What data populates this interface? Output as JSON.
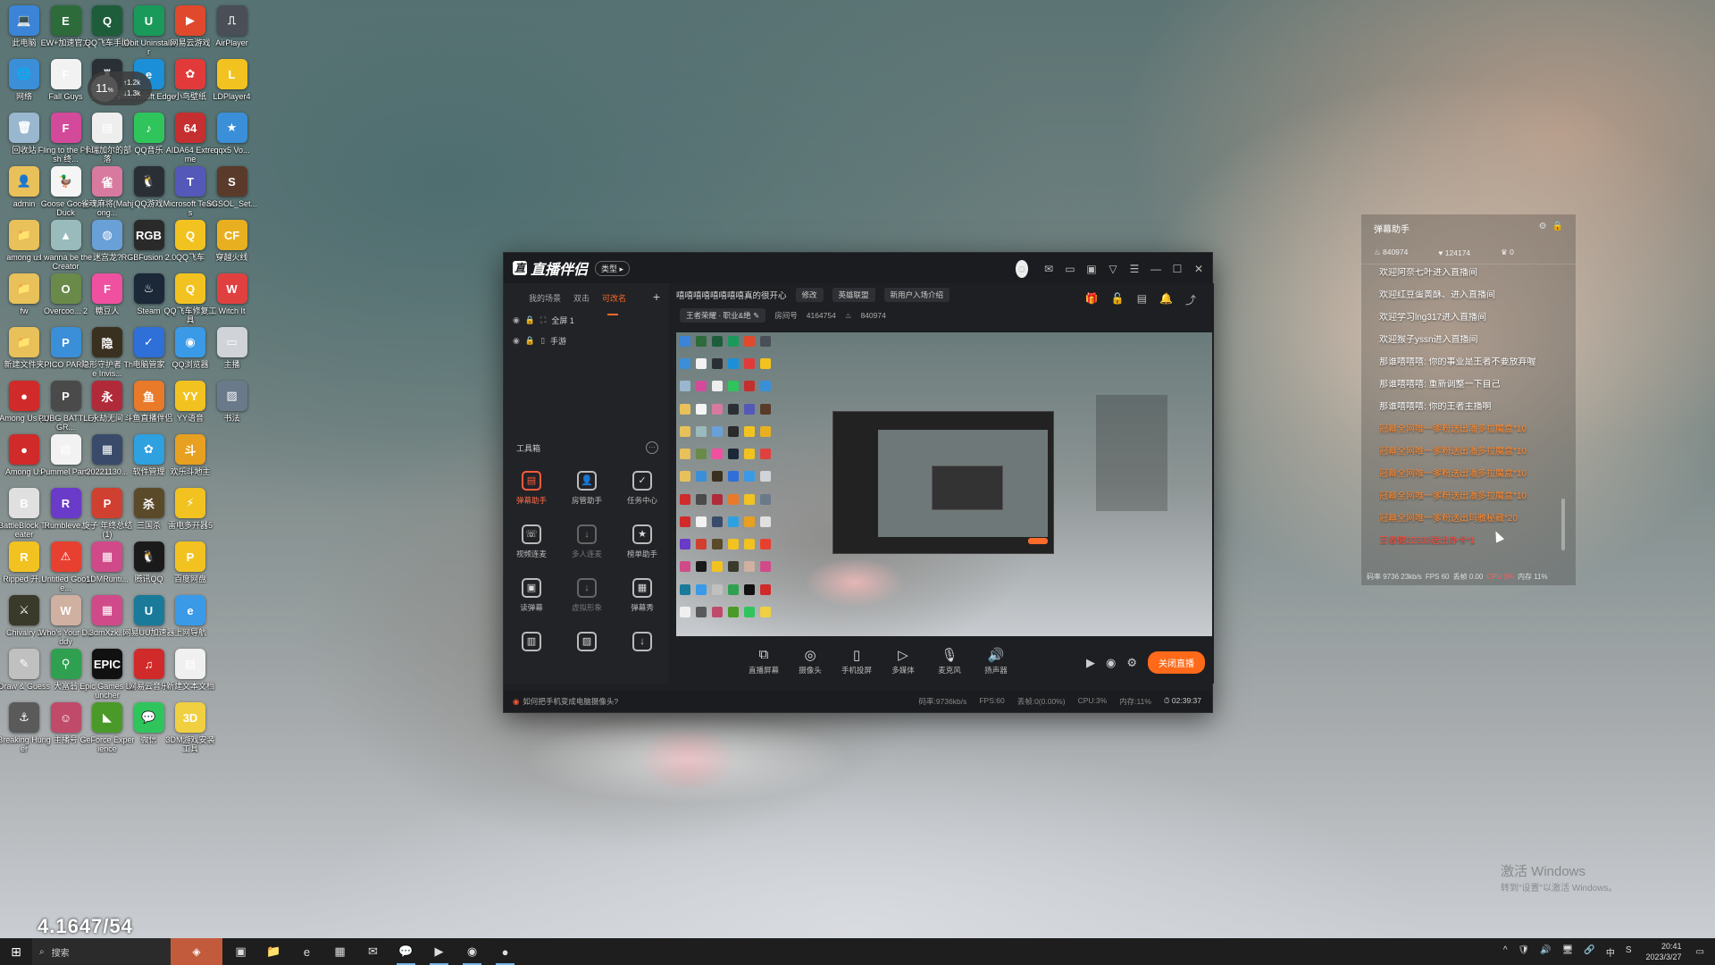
{
  "desktop": {
    "icons": [
      {
        "label": "此电脑",
        "color": "#3b84d8",
        "g": "💻",
        "col": 0,
        "row": 0
      },
      {
        "label": "EW+加速官方",
        "color": "#2d6b3a",
        "g": "E",
        "col": 1,
        "row": 0
      },
      {
        "label": "QQ飞车手游",
        "color": "#1d5d3a",
        "g": "Q",
        "col": 2,
        "row": 0
      },
      {
        "label": "IObit Uninstaller",
        "color": "#1a9a5a",
        "g": "U",
        "col": 3,
        "row": 0
      },
      {
        "label": "网易云游戏",
        "color": "#e0492c",
        "g": "▶",
        "col": 4,
        "row": 0
      },
      {
        "label": "AirPlayer",
        "color": "#4a4f57",
        "g": "⎍",
        "col": 5,
        "row": 0
      },
      {
        "label": "网络",
        "color": "#3a8fd8",
        "g": "🌐",
        "col": 0,
        "row": 1
      },
      {
        "label": "Fall Guys",
        "color": "#f2f2f2",
        "g": "F",
        "col": 1,
        "row": 1
      },
      {
        "label": "道具实录",
        "color": "#2a2f36",
        "g": "♜",
        "col": 2,
        "row": 1
      },
      {
        "label": "Microsoft Edge",
        "color": "#1b8fd8",
        "g": "e",
        "col": 3,
        "row": 1
      },
      {
        "label": "小鸟壁纸",
        "color": "#e23a3a",
        "g": "✿",
        "col": 4,
        "row": 1
      },
      {
        "label": "LDPlayer4",
        "color": "#f2c320",
        "g": "L",
        "col": 5,
        "row": 1
      },
      {
        "label": "回收站",
        "color": "#9ab7d0",
        "g": "🗑",
        "col": 0,
        "row": 2
      },
      {
        "label": "Fling to the Finish 终...",
        "color": "#d44a9a",
        "g": "F",
        "col": 1,
        "row": 2
      },
      {
        "label": "卡瑞加尔的部落",
        "color": "#eeeeee",
        "g": "▤",
        "col": 2,
        "row": 2
      },
      {
        "label": "QQ音乐",
        "color": "#2fc55c",
        "g": "♪",
        "col": 3,
        "row": 2
      },
      {
        "label": "AIDA64 Extreme",
        "color": "#c62f2f",
        "g": "64",
        "col": 4,
        "row": 2
      },
      {
        "label": "qqx5 Vo...",
        "color": "#3a8fd8",
        "g": "★",
        "col": 5,
        "row": 2
      },
      {
        "label": "admin",
        "color": "#e8c15a",
        "g": "👤",
        "col": 0,
        "row": 3
      },
      {
        "label": "Goose Goose Duck",
        "color": "#f5f5f5",
        "g": "🦆",
        "col": 1,
        "row": 3
      },
      {
        "label": "雀魂麻将(Mahjong...",
        "color": "#d87aa0",
        "g": "雀",
        "col": 2,
        "row": 3
      },
      {
        "label": "QQ游戏",
        "color": "#2a2f36",
        "g": "🐧",
        "col": 3,
        "row": 3
      },
      {
        "label": "Microsoft Teams",
        "color": "#5458b8",
        "g": "T",
        "col": 4,
        "row": 3
      },
      {
        "label": "SGSOL_Set...",
        "color": "#5a3a2a",
        "g": "S",
        "col": 5,
        "row": 3
      },
      {
        "label": "among us",
        "color": "#e8c15a",
        "g": "📁",
        "col": 0,
        "row": 4
      },
      {
        "label": "I wanna be the Creator",
        "color": "#9bb",
        "g": "▲",
        "col": 1,
        "row": 4
      },
      {
        "label": "迷宫龙?",
        "color": "#6aa0d8",
        "g": "◍",
        "col": 2,
        "row": 4
      },
      {
        "label": "RGBFusion 2.0",
        "color": "#2a2a2a",
        "g": "RGB",
        "col": 3,
        "row": 4
      },
      {
        "label": "QQ飞车",
        "color": "#f2c320",
        "g": "Q",
        "col": 4,
        "row": 4
      },
      {
        "label": "穿越火线",
        "color": "#e8b020",
        "g": "CF",
        "col": 5,
        "row": 4
      },
      {
        "label": "fw",
        "color": "#e8c15a",
        "g": "📁",
        "col": 0,
        "row": 5
      },
      {
        "label": "Overcoo... 2",
        "color": "#6a8a4a",
        "g": "O",
        "col": 1,
        "row": 5
      },
      {
        "label": "糖豆人",
        "color": "#f050a0",
        "g": "F",
        "col": 2,
        "row": 5
      },
      {
        "label": "Steam",
        "color": "#1b2838",
        "g": "♨",
        "col": 3,
        "row": 5
      },
      {
        "label": "QQ飞车修复工具",
        "color": "#f2c320",
        "g": "Q",
        "col": 4,
        "row": 5
      },
      {
        "label": "Witch It",
        "color": "#e04040",
        "g": "W",
        "col": 5,
        "row": 5
      },
      {
        "label": "新建文件夹",
        "color": "#e8c15a",
        "g": "📁",
        "col": 0,
        "row": 6
      },
      {
        "label": "PICO PARK",
        "color": "#3a8fd8",
        "g": "P",
        "col": 1,
        "row": 6
      },
      {
        "label": "隐形守护者 The Invis...",
        "color": "#3a3020",
        "g": "隐",
        "col": 2,
        "row": 6
      },
      {
        "label": "电脑管家",
        "color": "#2f6fd8",
        "g": "✓",
        "col": 3,
        "row": 6
      },
      {
        "label": "QQ浏览器",
        "color": "#3a9ae8",
        "g": "◉",
        "col": 4,
        "row": 6
      },
      {
        "label": "主播",
        "color": "#d0d4d8",
        "g": "▭",
        "col": 5,
        "row": 6
      },
      {
        "label": "Among Us (2)",
        "color": "#d02a2a",
        "g": "●",
        "col": 0,
        "row": 7
      },
      {
        "label": "PUBG BATTLEGR...",
        "color": "#4a4a4a",
        "g": "P",
        "col": 1,
        "row": 7
      },
      {
        "label": "永劫无间",
        "color": "#b02a3a",
        "g": "永",
        "col": 2,
        "row": 7
      },
      {
        "label": "斗鱼直播伴侣",
        "color": "#e87a2a",
        "g": "鱼",
        "col": 3,
        "row": 7
      },
      {
        "label": "YY语音",
        "color": "#f2c320",
        "g": "YY",
        "col": 4,
        "row": 7
      },
      {
        "label": "书法",
        "color": "#6a7a8a",
        "g": "▨",
        "col": 5,
        "row": 7
      },
      {
        "label": "Among Us",
        "color": "#d02a2a",
        "g": "●",
        "col": 0,
        "row": 8
      },
      {
        "label": "Pummel Party",
        "color": "#f2f2f2",
        "g": "▤",
        "col": 1,
        "row": 8
      },
      {
        "label": "20221130...",
        "color": "#3a4a6a",
        "g": "▦",
        "col": 2,
        "row": 8
      },
      {
        "label": "软件管理",
        "color": "#2fa0e0",
        "g": "✿",
        "col": 3,
        "row": 8
      },
      {
        "label": "欢乐斗地主",
        "color": "#e8a020",
        "g": "斗",
        "col": 4,
        "row": 8
      },
      {
        "label": "BattleBlock Theater",
        "color": "#e0e0e0",
        "g": "B",
        "col": 0,
        "row": 9
      },
      {
        "label": "Rumbleve...",
        "color": "#6a3ac8",
        "g": "R",
        "col": 1,
        "row": 9
      },
      {
        "label": "旋子 年终总结(1)",
        "color": "#d04030",
        "g": "P",
        "col": 2,
        "row": 9
      },
      {
        "label": "三国杀",
        "color": "#5a4a2a",
        "g": "杀",
        "col": 3,
        "row": 9
      },
      {
        "label": "雷电多开器5",
        "color": "#f2c320",
        "g": "⚡",
        "col": 4,
        "row": 9
      },
      {
        "label": "Ripped 开...",
        "color": "#f2c320",
        "g": "R",
        "col": 0,
        "row": 10
      },
      {
        "label": "Untitled Goose...",
        "color": "#e84030",
        "g": "⚠",
        "col": 1,
        "row": 10
      },
      {
        "label": "1DMRunti...",
        "color": "#d04a8a",
        "g": "▦",
        "col": 2,
        "row": 10
      },
      {
        "label": "腾讯QQ",
        "color": "#1a1a1a",
        "g": "🐧",
        "col": 3,
        "row": 10
      },
      {
        "label": "百度网盘",
        "color": "#f2c320",
        "g": "P",
        "col": 4,
        "row": 10
      },
      {
        "label": "Chivalry 2",
        "color": "#3a3a2a",
        "g": "⚔",
        "col": 0,
        "row": 11
      },
      {
        "label": "Who's Your Daddy",
        "color": "#d0b0a0",
        "g": "W",
        "col": 1,
        "row": 11
      },
      {
        "label": "3dmXzk...",
        "color": "#d04a8a",
        "g": "▦",
        "col": 2,
        "row": 11
      },
      {
        "label": "网易UU加速器",
        "color": "#1a7a9a",
        "g": "U",
        "col": 3,
        "row": 11
      },
      {
        "label": "上网导航",
        "color": "#3a9ae8",
        "g": "e",
        "col": 4,
        "row": 11
      },
      {
        "label": "Draw & Guess",
        "color": "#c0c0c0",
        "g": "✎",
        "col": 0,
        "row": 12
      },
      {
        "label": "大富翁",
        "color": "#2fa050",
        "g": "⚲",
        "col": 1,
        "row": 12
      },
      {
        "label": "Epic Games Launcher",
        "color": "#111111",
        "g": "EPIC",
        "col": 2,
        "row": 12
      },
      {
        "label": "网易云音乐",
        "color": "#d02a2a",
        "g": "♫",
        "col": 3,
        "row": 12
      },
      {
        "label": "新建文本文档",
        "color": "#f0f0f0",
        "g": "▤",
        "col": 4,
        "row": 12
      },
      {
        "label": "Breaking Hunger",
        "color": "#5a5a5a",
        "g": "⚓",
        "col": 0,
        "row": 13
      },
      {
        "label": "主播号",
        "color": "#c04a6a",
        "g": "☺",
        "col": 1,
        "row": 13
      },
      {
        "label": "GeForce Experience",
        "color": "#4a9a2a",
        "g": "◣",
        "col": 2,
        "row": 13
      },
      {
        "label": "微信",
        "color": "#2fc55c",
        "g": "💬",
        "col": 3,
        "row": 13
      },
      {
        "label": "3DM游戏安装工具",
        "color": "#f0d040",
        "g": "3D",
        "col": 4,
        "row": 13
      }
    ],
    "net_widget": {
      "percent": "11",
      "up": "1.2k",
      "down": "1.3k"
    },
    "counter": "4.1647/54"
  },
  "app": {
    "logo": "直播伴侣",
    "type_badge": "类型 ▸",
    "tabs": [
      "我的场景",
      "双击",
      "可改名"
    ],
    "active_tab": 2,
    "scenes": [
      "全屏 1",
      "手游"
    ],
    "room_title": "嘻嘻嘻嘻嘻嘻嘻嘻真的很开心",
    "edit_label": "修改",
    "category": "英雄联盟",
    "intro": "新用户入场介绍",
    "game_tag": "王者荣耀 · 职业&绝 ✎",
    "room_label": "房间号",
    "room_id": "4164754",
    "heat": "840974",
    "toolbox_label": "工具箱",
    "tools": [
      {
        "label": "弹幕助手",
        "g": "▤",
        "style": "red"
      },
      {
        "label": "房管助手",
        "g": "👤",
        "style": ""
      },
      {
        "label": "任务中心",
        "g": "✓",
        "style": ""
      },
      {
        "label": "视频连麦",
        "g": "☏",
        "style": ""
      },
      {
        "label": "多人连麦",
        "g": "↓",
        "style": "dim"
      },
      {
        "label": "榜单助手",
        "g": "★",
        "style": ""
      },
      {
        "label": "读弹幕",
        "g": "▣",
        "style": ""
      },
      {
        "label": "虚拟形象",
        "g": "↓",
        "style": "dim"
      },
      {
        "label": "弹幕秀",
        "g": "▦",
        "style": ""
      },
      {
        "label": "",
        "g": "▥",
        "style": ""
      },
      {
        "label": "",
        "g": "▨",
        "style": ""
      },
      {
        "label": "",
        "g": "↓",
        "style": ""
      }
    ],
    "controls": [
      {
        "label": "直播屏幕",
        "g": "⧉"
      },
      {
        "label": "摄像头",
        "g": "◎"
      },
      {
        "label": "手机投屏",
        "g": "▯"
      },
      {
        "label": "多媒体",
        "g": "▷"
      },
      {
        "label": "麦克风",
        "g": "🎙"
      },
      {
        "label": "扬声器",
        "g": "🔊"
      }
    ],
    "stop_label": "关闭直播",
    "status_tip": "如何把手机变成电脑摄像头?",
    "stats": {
      "bitrate": "码率:9736kb/s",
      "fps": "FPS:60",
      "drop": "丢帧:0(0.00%)",
      "cpu": "CPU:3%",
      "mem": "内存:11%",
      "time": "02:39:37"
    }
  },
  "chat": {
    "title": "弹幕助手",
    "stats": {
      "likes": "840974",
      "hearts": "124174",
      "crowns": "0"
    },
    "messages": [
      {
        "t": "欢迎阿奈七叶进入直播间",
        "c": "w"
      },
      {
        "t": "欢迎红豆蛋黄酥、进入直播间",
        "c": "w"
      },
      {
        "t": "欢迎学习lng317进入直播间",
        "c": "w"
      },
      {
        "t": "欢迎猴子yssn进入直播间",
        "c": "w"
      },
      {
        "t": "那谁嘻嘻嘻: 你的事业是王者不要放弃喔",
        "c": "w"
      },
      {
        "t": "那谁嘻嘻嘻: 重新调整一下自己",
        "c": "w"
      },
      {
        "t": "那谁嘻嘻嘻: 你的王者主播啊",
        "c": "w"
      },
      {
        "t": "冠幕全网唯一爹粉送出潘多拉魔盒*10",
        "c": "g"
      },
      {
        "t": "冠幕全网唯一爹粉送出潘多拉魔盒*10",
        "c": "g"
      },
      {
        "t": "冠幕全网唯一爹粉送出潘多拉魔盒*10",
        "c": "g"
      },
      {
        "t": "冠幕全网唯一爹粉送出潘多拉魔盒*10",
        "c": "g"
      },
      {
        "t": "冠幕全网唯一爹粉送出玛雅秘藏*20",
        "c": "g"
      },
      {
        "t": "王者健22333送出办卡*1",
        "c": "r"
      },
      {
        "t": "和事不佳在tardis送出嘉年华*1",
        "c": "r"
      }
    ],
    "footer": {
      "bitrate": "码率 9736 23kb/s",
      "fps": "FPS 60",
      "drop": "丢帧 0.00",
      "cpu": "CPU 3%",
      "mem": "内存 11%"
    }
  },
  "watermark": {
    "title": "激活 Windows",
    "sub": "转到\"设置\"以激活 Windows。"
  },
  "taskbar": {
    "search_placeholder": "搜索",
    "apps": [
      {
        "g": "▣",
        "name": "task-view"
      },
      {
        "g": "📁",
        "name": "explorer"
      },
      {
        "g": "e",
        "name": "edge"
      },
      {
        "g": "▦",
        "name": "store"
      },
      {
        "g": "✉",
        "name": "mail"
      },
      {
        "g": "💬",
        "name": "wechat"
      },
      {
        "g": "▶",
        "name": "live-companion"
      },
      {
        "g": "◉",
        "name": "qq-browser"
      },
      {
        "g": "●",
        "name": "qq-music"
      }
    ],
    "tray": [
      "^",
      "🛡",
      "🔊",
      "🖥",
      "🔗",
      "中",
      "S"
    ],
    "time": "20:41",
    "date": "2023/3/27"
  }
}
